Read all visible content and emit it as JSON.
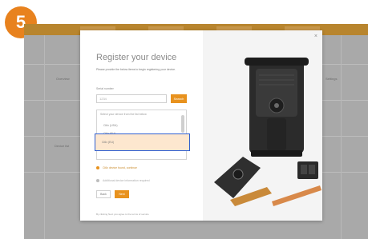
{
  "step": {
    "number": "5"
  },
  "dialog": {
    "title": "Register your device",
    "description": "Please provide the below items to begin registering your device.",
    "serial_label": "Serial number",
    "serial_value": "1234",
    "search_label": "Search",
    "dropdown_header": "Select your device from the list below",
    "options": [
      "Ci6x (USA)",
      "Ci6x (EU)"
    ],
    "highlighted_option": "Ci6x (EU)",
    "status_found": "Ci6x device found, continue",
    "status_info": "Additional device information required",
    "back_label": "Back",
    "next_label": "Next",
    "footer_text": "By clicking Next you agree to the terms of service",
    "close_glyph": "×"
  },
  "colors": {
    "accent": "#e8921e",
    "badge": "#e8821e",
    "highlight_border": "#2f5fd0",
    "highlight_fill": "#fde7cf"
  },
  "background_app": {
    "row_labels": [
      "Overview",
      "Device list",
      "Settings"
    ]
  },
  "icons": {
    "close": "close-icon",
    "status_found": "warning-dot-icon",
    "status_info": "info-dot-icon"
  }
}
